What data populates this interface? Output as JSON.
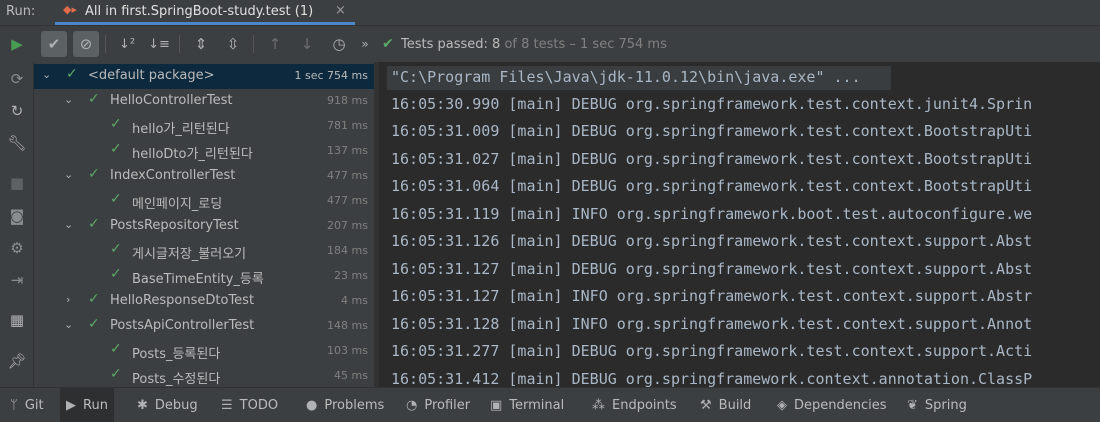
{
  "run": {
    "label": "Run:",
    "tab_title": "All in first.SpringBoot-study.test (1)",
    "tab_close": "×"
  },
  "toolbar": {
    "status_passed": "Tests passed: 8",
    "status_detail": " of 8 tests – 1 sec 754 ms"
  },
  "tree": {
    "rows": [
      {
        "label": "<default package>",
        "time": "1 sec 754 ms"
      },
      {
        "label": "HelloControllerTest",
        "time": "918 ms"
      },
      {
        "label": "hello가_리턴된다",
        "time": "781 ms"
      },
      {
        "label": "helloDto가_리턴된다",
        "time": "137 ms"
      },
      {
        "label": "IndexControllerTest",
        "time": "477 ms"
      },
      {
        "label": "메인페이지_로딩",
        "time": "477 ms"
      },
      {
        "label": "PostsRepositoryTest",
        "time": "207 ms"
      },
      {
        "label": "게시글저장_불러오기",
        "time": "184 ms"
      },
      {
        "label": "BaseTimeEntity_등록",
        "time": "23 ms"
      },
      {
        "label": "HelloResponseDtoTest",
        "time": "4 ms"
      },
      {
        "label": "PostsApiControllerTest",
        "time": "148 ms"
      },
      {
        "label": "Posts_등록된다",
        "time": "103 ms"
      },
      {
        "label": "Posts_수정된다",
        "time": "45 ms"
      }
    ]
  },
  "console": {
    "command": "\"C:\\Program Files\\Java\\jdk-11.0.12\\bin\\java.exe\" ...",
    "lines": [
      "16:05:30.990 [main] DEBUG org.springframework.test.context.junit4.Sprin",
      "16:05:31.009 [main] DEBUG org.springframework.test.context.BootstrapUti",
      "16:05:31.027 [main] DEBUG org.springframework.test.context.BootstrapUti",
      "16:05:31.064 [main] DEBUG org.springframework.test.context.BootstrapUti",
      "16:05:31.119 [main] INFO org.springframework.boot.test.autoconfigure.we",
      "16:05:31.126 [main] DEBUG org.springframework.test.context.support.Abst",
      "16:05:31.127 [main] DEBUG org.springframework.test.context.support.Abst",
      "16:05:31.127 [main] INFO org.springframework.test.context.support.Abstr",
      "16:05:31.128 [main] INFO org.springframework.test.context.support.Annot",
      "16:05:31.277 [main] DEBUG org.springframework.test.context.support.Acti",
      "16:05:31.412 [main] DEBUG org.springframework.context.annotation.ClassP"
    ]
  },
  "bottom_tabs": [
    {
      "label": "Git",
      "icon": "git-branch-icon"
    },
    {
      "label": "Run",
      "icon": "play-icon"
    },
    {
      "label": "Debug",
      "icon": "bug-icon"
    },
    {
      "label": "TODO",
      "icon": "list-icon"
    },
    {
      "label": "Problems",
      "icon": "warning-icon"
    },
    {
      "label": "Profiler",
      "icon": "gauge-icon"
    },
    {
      "label": "Terminal",
      "icon": "terminal-icon"
    },
    {
      "label": "Endpoints",
      "icon": "endpoints-icon"
    },
    {
      "label": "Build",
      "icon": "hammer-icon"
    },
    {
      "label": "Dependencies",
      "icon": "layers-icon"
    },
    {
      "label": "Spring",
      "icon": "leaf-icon"
    }
  ],
  "colors": {
    "pass_green": "#5ca868",
    "selection": "#0d293e",
    "tab_underline": "#4a88c7",
    "rerun_green": "#499c54"
  }
}
